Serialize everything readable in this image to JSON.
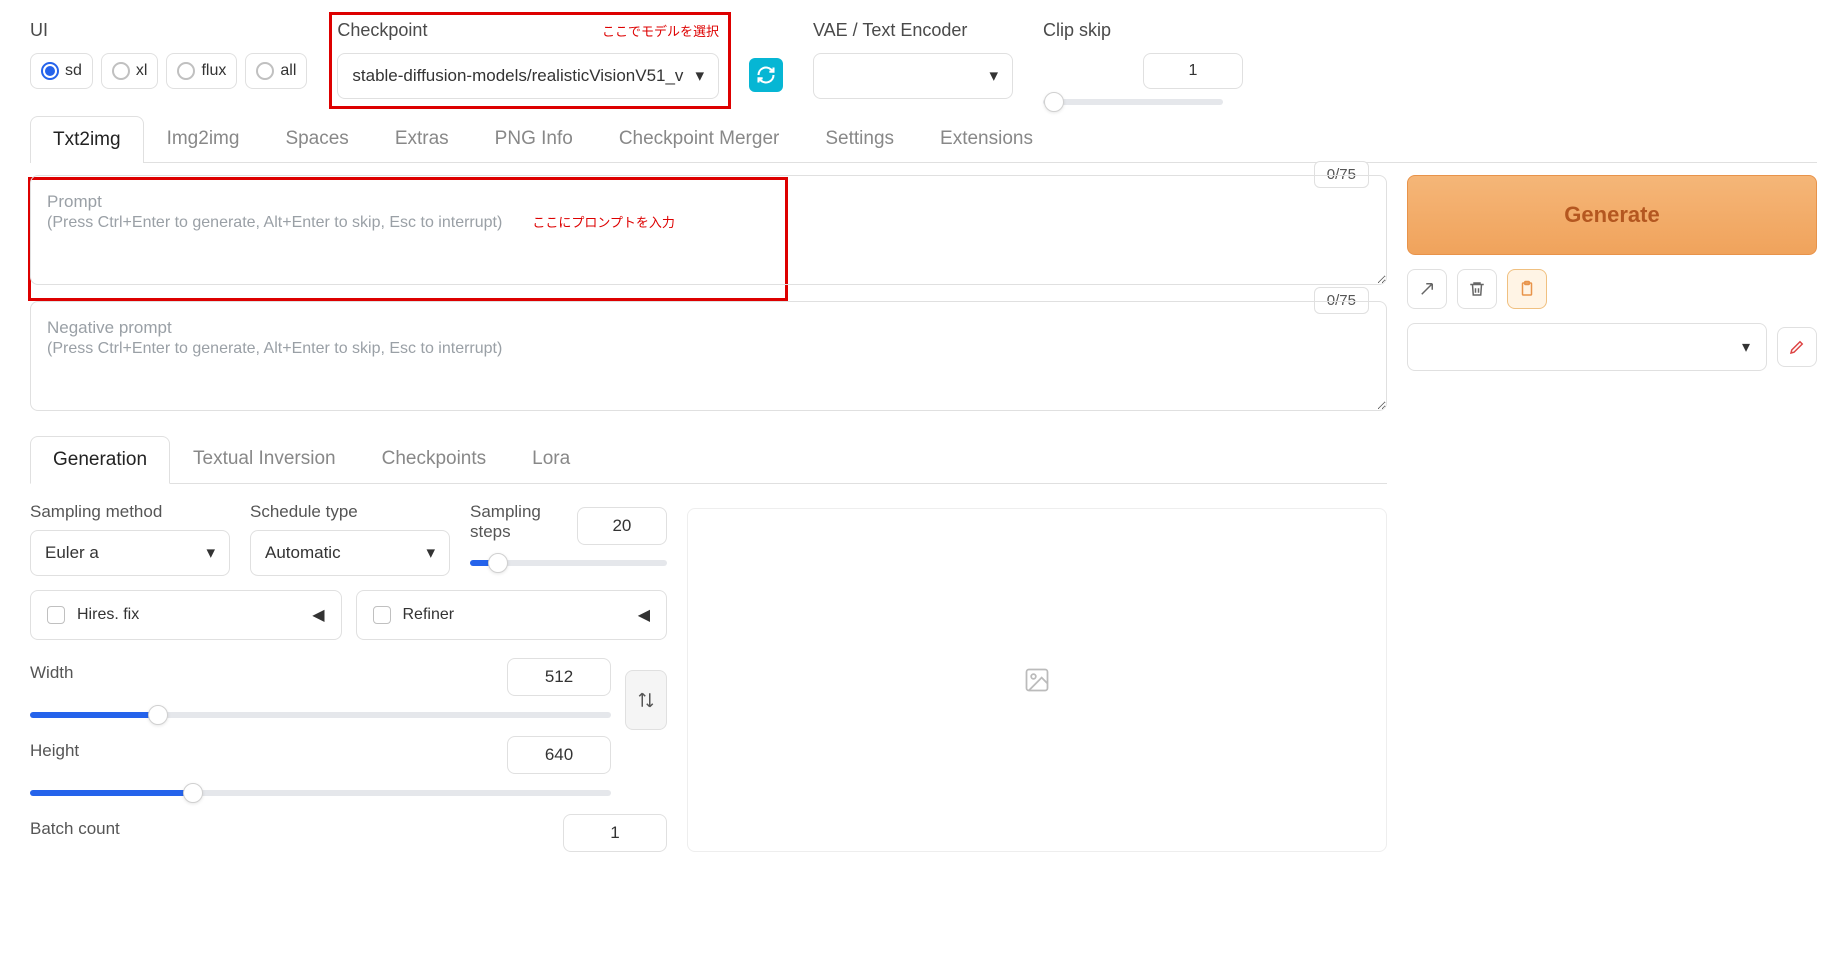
{
  "top": {
    "ui_label": "UI",
    "radios": [
      "sd",
      "xl",
      "flux",
      "all"
    ],
    "radio_selected": 0,
    "checkpoint_label": "Checkpoint",
    "checkpoint_value": "stable-diffusion-models/realisticVisionV51_v",
    "checkpoint_note": "ここでモデルを選択",
    "vae_label": "VAE / Text Encoder",
    "clip_label": "Clip skip",
    "clip_value": "1"
  },
  "tabs": [
    "Txt2img",
    "Img2img",
    "Spaces",
    "Extras",
    "PNG Info",
    "Checkpoint Merger",
    "Settings",
    "Extensions"
  ],
  "tab_active": 0,
  "prompt": {
    "label": "Prompt",
    "hint": "(Press Ctrl+Enter to generate, Alt+Enter to skip, Esc to interrupt)",
    "tokens": "0/75",
    "note": "ここにプロンプトを入力"
  },
  "neg": {
    "label": "Negative prompt",
    "hint": "(Press Ctrl+Enter to generate, Alt+Enter to skip, Esc to interrupt)",
    "tokens": "0/75"
  },
  "generate": "Generate",
  "subtabs": [
    "Generation",
    "Textual Inversion",
    "Checkpoints",
    "Lora"
  ],
  "subtab_active": 0,
  "gen": {
    "sampling_method_label": "Sampling method",
    "sampling_method_value": "Euler a",
    "schedule_label": "Schedule type",
    "schedule_value": "Automatic",
    "steps_label": "Sampling steps",
    "steps_value": "20",
    "hires_label": "Hires. fix",
    "refiner_label": "Refiner",
    "width_label": "Width",
    "width_value": "512",
    "height_label": "Height",
    "height_value": "640",
    "batch_count_label": "Batch count",
    "batch_count_value": "1"
  }
}
